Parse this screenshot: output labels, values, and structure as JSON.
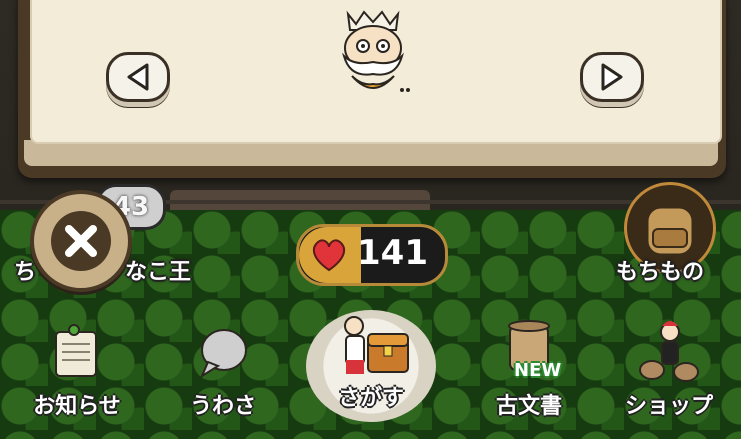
{
  "hud": {
    "close_icon": "close-icon",
    "level_badge": "43",
    "hearts_count": "141",
    "heart_icon": "heart-icon"
  },
  "labels": {
    "chi": "ち",
    "nakoou": "なこ王",
    "mochimono": "もちもの"
  },
  "nav": [
    {
      "label": "お知らせ",
      "icon": "notice-board-icon"
    },
    {
      "label": "うわさ",
      "icon": "speech-bubble-icon"
    },
    {
      "label": "さがす",
      "icon": "treasure-chest-icon"
    },
    {
      "label": "古文書",
      "icon": "scroll-icon",
      "badge": "NEW"
    },
    {
      "label": "ショップ",
      "icon": "shop-icon"
    }
  ],
  "colors": {
    "accent": "#d9a53a",
    "panel": "#f3ecd9",
    "heart": "#e0343a",
    "new": "#2d8a32"
  }
}
